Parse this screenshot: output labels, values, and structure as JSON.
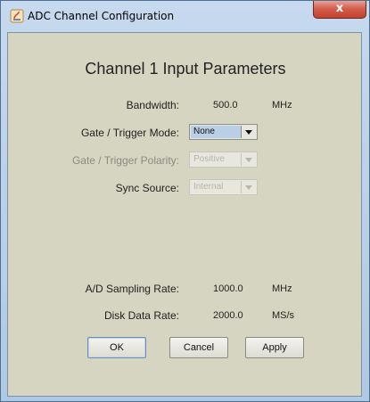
{
  "window": {
    "title": "ADC Channel Configuration",
    "close_label": "x"
  },
  "form": {
    "heading": "Channel 1 Input Parameters",
    "bandwidth": {
      "label": "Bandwidth:",
      "value": "500.0",
      "unit": "MHz"
    },
    "gate_trigger_mode": {
      "label": "Gate / Trigger Mode:",
      "selected": "None",
      "enabled": true
    },
    "gate_trigger_polarity": {
      "label": "Gate / Trigger Polarity:",
      "selected": "Positive",
      "enabled": false
    },
    "sync_source": {
      "label": "Sync Source:",
      "selected": "Internal",
      "enabled": false
    },
    "sampling_rate": {
      "label": "A/D Sampling Rate:",
      "value": "1000.0",
      "unit": "MHz"
    },
    "disk_data_rate": {
      "label": "Disk Data Rate:",
      "value": "2000.0",
      "unit": "MS/s"
    }
  },
  "buttons": {
    "ok": "OK",
    "cancel": "Cancel",
    "apply": "Apply"
  },
  "colors": {
    "panel_background": "#d5d5c1",
    "titlebar": "#b7cfe8",
    "close_button": "#c9503c",
    "selected_combo": "#b8cfe5"
  }
}
